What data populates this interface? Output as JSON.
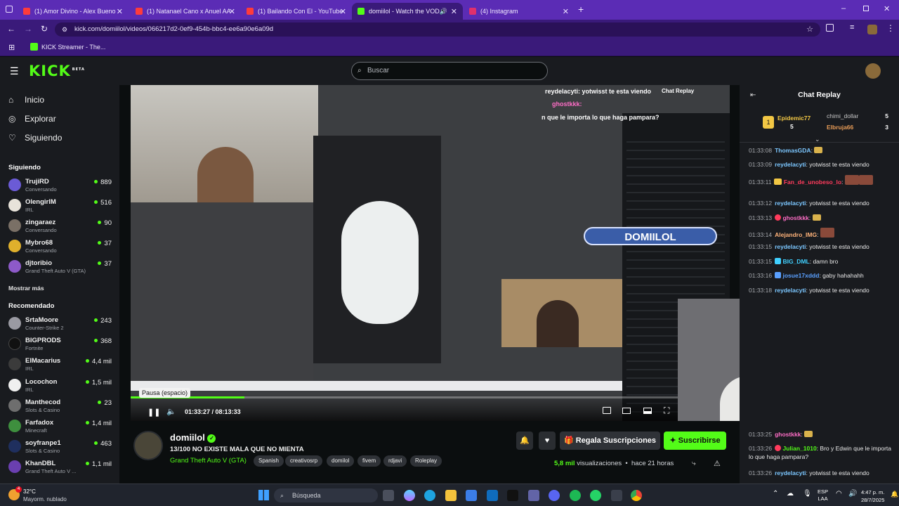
{
  "browser": {
    "tabs": [
      {
        "label": "(1) Amor Divino - Alex Bueno",
        "color": "#ff3b3b"
      },
      {
        "label": "(1) Natanael Cano x Anuel AA",
        "color": "#ff3b3b"
      },
      {
        "label": "(1) Bailando Con El - YouTube",
        "color": "#ff3b3b"
      },
      {
        "label": "domiilol - Watch the VOD o",
        "color": "#53fc18"
      },
      {
        "label": "(4) Instagram",
        "color": "#e1306c"
      }
    ],
    "url": "kick.com/domiilol/videos/066217d2-0ef9-454b-bbc4-ee6a90e6a09d",
    "bookmark": "KICK Streamer - The..."
  },
  "header": {
    "logo": "KICK",
    "logo_badge": "BETA",
    "search_placeholder": "Buscar"
  },
  "sidebar": {
    "nav": [
      {
        "label": "Inicio",
        "icon": "home-icon"
      },
      {
        "label": "Explorar",
        "icon": "compass-icon"
      },
      {
        "label": "Siguiendo",
        "icon": "heart-icon"
      }
    ],
    "following_title": "Siguiendo",
    "following": [
      {
        "name": "TrujiRD",
        "sub": "Conversando",
        "viewers": "889",
        "color": "#6b5bd6"
      },
      {
        "name": "OlengirlM",
        "sub": "IRL",
        "viewers": "516",
        "color": "#e8e3da"
      },
      {
        "name": "zingaraez",
        "sub": "Conversando",
        "viewers": "90",
        "color": "#7a7066"
      },
      {
        "name": "Mybro68",
        "sub": "Conversando",
        "viewers": "37",
        "color": "#e0b02c"
      },
      {
        "name": "djtoribio",
        "sub": "Grand Theft Auto V (GTA)",
        "viewers": "37",
        "color": "#8d5ac8"
      }
    ],
    "show_more": "Mostrar más",
    "recommended_title": "Recomendado",
    "recommended": [
      {
        "name": "SrtaMoore",
        "sub": "Counter-Strike 2",
        "viewers": "243",
        "color": "#9a9aa2"
      },
      {
        "name": "BIGPRODS",
        "sub": "Fortnite",
        "viewers": "368",
        "color": "#111111"
      },
      {
        "name": "ElMacarius",
        "sub": "IRL",
        "viewers": "4,4 mil",
        "color": "#3b3b3b"
      },
      {
        "name": "Locochon",
        "sub": "IRL",
        "viewers": "1,5 mil",
        "color": "#f0f0f0"
      },
      {
        "name": "Manthecod",
        "sub": "Slots & Casino",
        "viewers": "23",
        "color": "#6e6e6e"
      },
      {
        "name": "Farfadox",
        "sub": "Minecraft",
        "viewers": "1,4 mil",
        "color": "#3e8f3e"
      },
      {
        "name": "soyfranpe1",
        "sub": "Slots & Casino",
        "viewers": "463",
        "color": "#1f2f5e"
      },
      {
        "name": "KhanDBL",
        "sub": "Grand Theft Auto V ...",
        "viewers": "1,1 mil",
        "color": "#6a3fb0"
      }
    ]
  },
  "player": {
    "time_current": "01:33:27",
    "time_total": "08:13:33",
    "progress": 0.19,
    "tooltip": "Pausa (espacio)",
    "overlay_logo": "DOMIILOL",
    "overlay_chat_1": "reydelacyti: yotwisst te esta viendo",
    "overlay_chat_2": "ghostkkk:",
    "overlay_chat_3": "n que le importa lo que haga pampara?",
    "overlay_chat_replay": "Chat Replay"
  },
  "chat": {
    "title": "Chat Replay",
    "top_gifters": [
      {
        "name": "Epidemic77",
        "count": "5",
        "color": "#f2c744"
      },
      {
        "name": "chimi_dollar",
        "count": "5",
        "color": "#c7c7c7"
      },
      {
        "name": "Elbruja66",
        "count": "3",
        "color": "#e89c57"
      }
    ],
    "messages": [
      {
        "ts": "01:33:08",
        "user": "ThomasGDA",
        "color": "#7cc7ff",
        "text": ""
      },
      {
        "ts": "01:33:09",
        "user": "reydelacyti",
        "color": "#7cc7ff",
        "text": "yotwisst te esta viendo"
      },
      {
        "ts": "01:33:11",
        "user": "Fan_de_unobeso_lo",
        "color": "#ff3b5c",
        "text": ""
      },
      {
        "ts": "01:33:12",
        "user": "reydelacyti",
        "color": "#7cc7ff",
        "text": "yotwisst te esta viendo"
      },
      {
        "ts": "01:33:13",
        "user": "ghostkkk",
        "color": "#ff6ec7",
        "text": ""
      },
      {
        "ts": "01:33:14",
        "user": "Alejandro_IMG",
        "color": "#ffb37a",
        "text": ""
      },
      {
        "ts": "01:33:15",
        "user": "reydelacyti",
        "color": "#7cc7ff",
        "text": "yotwisst te esta viendo"
      },
      {
        "ts": "01:33:15",
        "user": "BIG_DML",
        "color": "#40d0ff",
        "text": "damn bro"
      },
      {
        "ts": "01:33:16",
        "user": "josue17xddd",
        "color": "#5aa0ff",
        "text": "gaby hahahahh"
      },
      {
        "ts": "01:33:18",
        "user": "reydelacyti",
        "color": "#7cc7ff",
        "text": "yotwisst te esta viendo"
      },
      {
        "ts": "01:33:25",
        "user": "ghostkkk",
        "color": "#ff6ec7",
        "text": ""
      },
      {
        "ts": "01:33:26",
        "user": "Julian_1010",
        "color": "#53fc18",
        "text": "Bro y Edwin que le importa lo que haga pampara?"
      },
      {
        "ts": "01:33:26",
        "user": "reydelacyti",
        "color": "#7cc7ff",
        "text": "yotwisst te esta viendo"
      }
    ]
  },
  "channel": {
    "name": "domiilol",
    "title": "13/100 NO EXISTE MALA QUE NO MIENTA",
    "category": "Grand Theft Auto V (GTA)",
    "tags": [
      "Spanish",
      "creativosrp",
      "domilol",
      "fivem",
      "rdjavi",
      "Roleplay"
    ],
    "gift_label": "Regala Suscripciones",
    "subscribe_label": "Suscribirse",
    "views": "5,8 mil",
    "views_suffix": "visualizaciones",
    "age": "hace 21 horas"
  },
  "taskbar": {
    "weather_temp": "32°C",
    "weather_desc": "Mayorm. nublado",
    "search_label": "Búsqueda",
    "lang": "ESP",
    "lang_sub": "LAA",
    "time": "4:47 p. m.",
    "date": "28/7/2025"
  }
}
